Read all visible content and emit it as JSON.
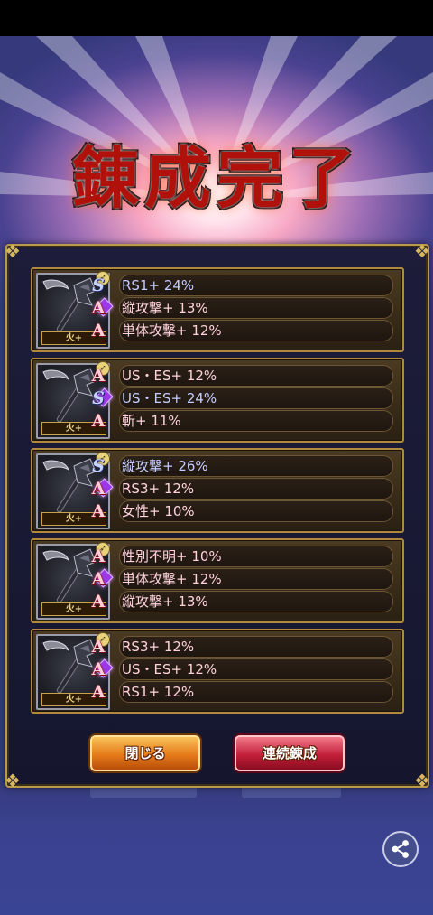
{
  "title": "錬成完了",
  "element_badge": "火+",
  "results": [
    {
      "rows": [
        {
          "grade": "S",
          "text": "RS1+ 24%"
        },
        {
          "grade": "A",
          "text": "縦攻撃+ 13%"
        },
        {
          "grade": "A",
          "text": "単体攻撃+ 12%"
        }
      ]
    },
    {
      "rows": [
        {
          "grade": "A",
          "text": "US・ES+ 12%"
        },
        {
          "grade": "S",
          "text": "US・ES+ 24%"
        },
        {
          "grade": "A",
          "text": "斬+ 11%"
        }
      ]
    },
    {
      "rows": [
        {
          "grade": "S",
          "text": "縦攻撃+ 26%"
        },
        {
          "grade": "A",
          "text": "RS3+ 12%"
        },
        {
          "grade": "A",
          "text": "女性+ 10%"
        }
      ]
    },
    {
      "rows": [
        {
          "grade": "A",
          "text": "性別不明+ 10%"
        },
        {
          "grade": "A",
          "text": "単体攻撃+ 12%"
        },
        {
          "grade": "A",
          "text": "縦攻撃+ 13%"
        }
      ]
    },
    {
      "rows": [
        {
          "grade": "A",
          "text": "RS3+ 12%"
        },
        {
          "grade": "A",
          "text": "US・ES+ 12%"
        },
        {
          "grade": "A",
          "text": "RS1+ 12%"
        }
      ]
    }
  ],
  "buttons": {
    "close": "閉じる",
    "continue": "連続錬成"
  },
  "icons": {
    "weapon": "axe-weapon-icon",
    "share": "share-icon",
    "gem": "purple-gem-icon",
    "rarity": "rarity-icon"
  },
  "colors": {
    "grade_s": "#c4cdff",
    "grade_a": "#ffd2dc",
    "frame_gold": "#b89a4a"
  }
}
